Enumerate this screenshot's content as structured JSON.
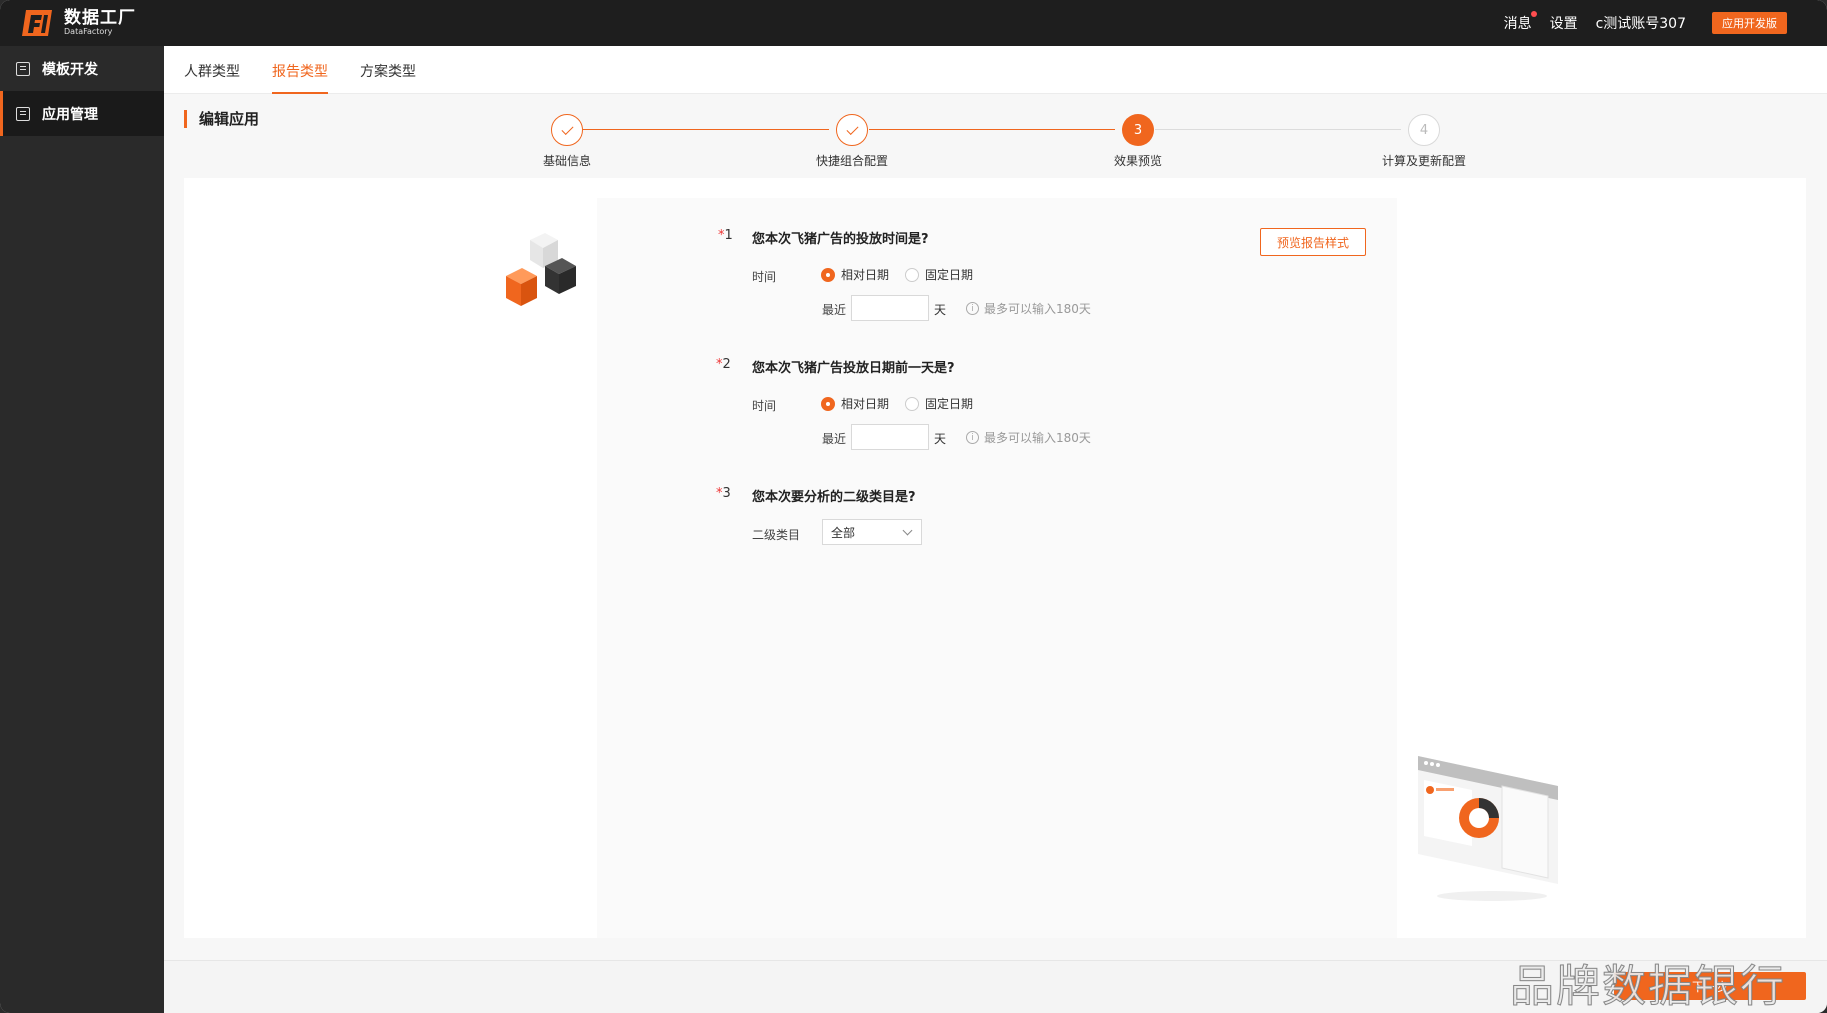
{
  "app": {
    "logo_cn": "数据工厂",
    "logo_en": "DataFactory"
  },
  "topbar": {
    "messages": "消息",
    "settings": "设置",
    "account": "c测试账号307",
    "version_badge": "应用开发版"
  },
  "sidebar": {
    "items": [
      {
        "label": "模板开发",
        "icon": "template-icon",
        "active": false
      },
      {
        "label": "应用管理",
        "icon": "app-manage-icon",
        "active": true
      }
    ]
  },
  "tabs": [
    {
      "label": "人群类型",
      "active": false
    },
    {
      "label": "报告类型",
      "active": true
    },
    {
      "label": "方案类型",
      "active": false
    }
  ],
  "page_title": "编辑应用",
  "steps": [
    {
      "index": "1",
      "label": "基础信息",
      "state": "done"
    },
    {
      "index": "2",
      "label": "快捷组合配置",
      "state": "done"
    },
    {
      "index": "3",
      "label": "效果预览",
      "state": "current"
    },
    {
      "index": "4",
      "label": "计算及更新配置",
      "state": "todo"
    }
  ],
  "preview_button": "预览报告样式",
  "questions": [
    {
      "star": "*",
      "num": "1",
      "title": "您本次飞猪广告的投放时间是?",
      "field_label": "时间",
      "radio_relative": "相对日期",
      "radio_fixed": "固定日期",
      "selected": "relative",
      "recent_label": "最近",
      "recent_value": "",
      "unit": "天",
      "hint": "最多可以输入180天"
    },
    {
      "star": "*",
      "num": "2",
      "title": "您本次飞猪广告投放日期前一天是?",
      "field_label": "时间",
      "radio_relative": "相对日期",
      "radio_fixed": "固定日期",
      "selected": "relative",
      "recent_label": "最近",
      "recent_value": "",
      "unit": "天",
      "hint": "最多可以输入180天"
    },
    {
      "star": "*",
      "num": "3",
      "title": "您本次要分析的二级类目是?",
      "field_label": "二级类目",
      "select_value": "全部"
    }
  ],
  "next_button": "下一步",
  "watermark": "品牌数据银行",
  "colors": {
    "accent": "#f0661e",
    "topbar": "#1e1e1e",
    "sidebar": "#2a2a2a"
  }
}
